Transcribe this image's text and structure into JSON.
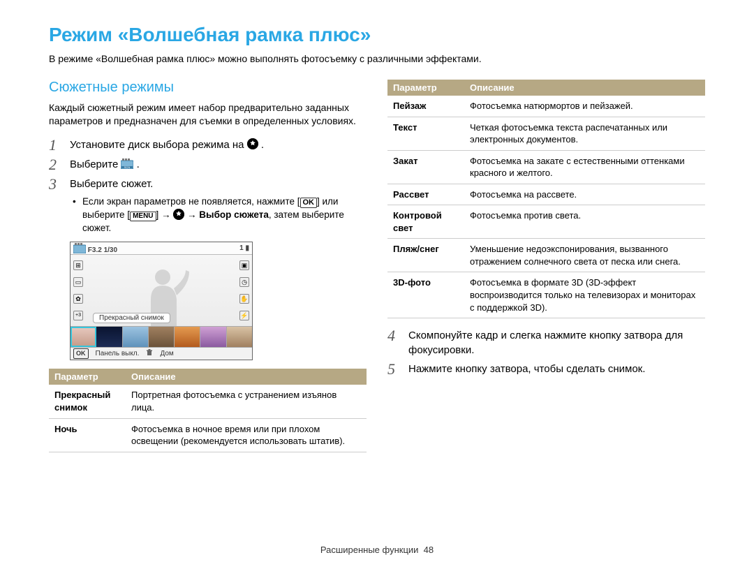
{
  "title": "Режим «Волшебная рамка плюс»",
  "intro": "В режиме «Волшебная рамка плюс» можно выполнять фотосъемку с различными эффектами.",
  "subhead": "Сюжетные режимы",
  "subtext": "Каждый сюжетный режим имеет набор предварительно заданных параметров и предназначен для съемки в определенных условиях.",
  "steps": {
    "s1_prefix": "Установите диск выбора режима на ",
    "s1_suffix": ".",
    "s2_prefix": "Выберите ",
    "s2_suffix": ".",
    "s3_main": "Выберите сюжет.",
    "s3_sub_a": "Если экран параметров не появляется, нажмите [",
    "s3_sub_b": "] или выберите [",
    "s3_sub_c": "] → ",
    "s3_sub_d": " → ",
    "s3_sub_bold": "Выбор сюжета",
    "s3_sub_e": ", затем выберите сюжет.",
    "s4": "Скомпонуйте кадр и слегка нажмите кнопку затвора для фокусировки.",
    "s5": "Нажмите кнопку затвора, чтобы сделать снимок."
  },
  "ok_label": "OK",
  "menu_label": "MENU",
  "preview": {
    "top_left": "F3.2 1/30",
    "top_right": "1",
    "label": "Прекрасный снимок",
    "bottom_panel": "Панель выкл.",
    "bottom_home": "Дом"
  },
  "table_headers": {
    "param": "Параметр",
    "desc": "Описание"
  },
  "table_left": [
    {
      "param": "Прекрасный снимок",
      "desc": "Портретная фотосъемка с устранением изъянов лица."
    },
    {
      "param": "Ночь",
      "desc": "Фотосъемка в ночное время или при плохом освещении (рекомендуется использовать штатив)."
    }
  ],
  "table_right": [
    {
      "param": "Пейзаж",
      "desc": "Фотосъемка натюрмортов и пейзажей."
    },
    {
      "param": "Текст",
      "desc": "Четкая фотосъемка текста распечатанных или электронных документов."
    },
    {
      "param": "Закат",
      "desc": "Фотосъемка на закате с естественными оттенками красного и желтого."
    },
    {
      "param": "Рассвет",
      "desc": "Фотосъемка на рассвете."
    },
    {
      "param": "Контровой свет",
      "desc": "Фотосъемка против света."
    },
    {
      "param": "Пляж/снег",
      "desc": "Уменьшение недоэкспонирования, вызванного отражением солнечного света от песка или снега."
    },
    {
      "param": "3D-фото",
      "desc": "Фотосъемка в формате 3D (3D-эффект воспроизводится только на телевизорах и мониторах с поддержкой 3D)."
    }
  ],
  "footer": {
    "section": "Расширенные функции",
    "page": "48"
  }
}
